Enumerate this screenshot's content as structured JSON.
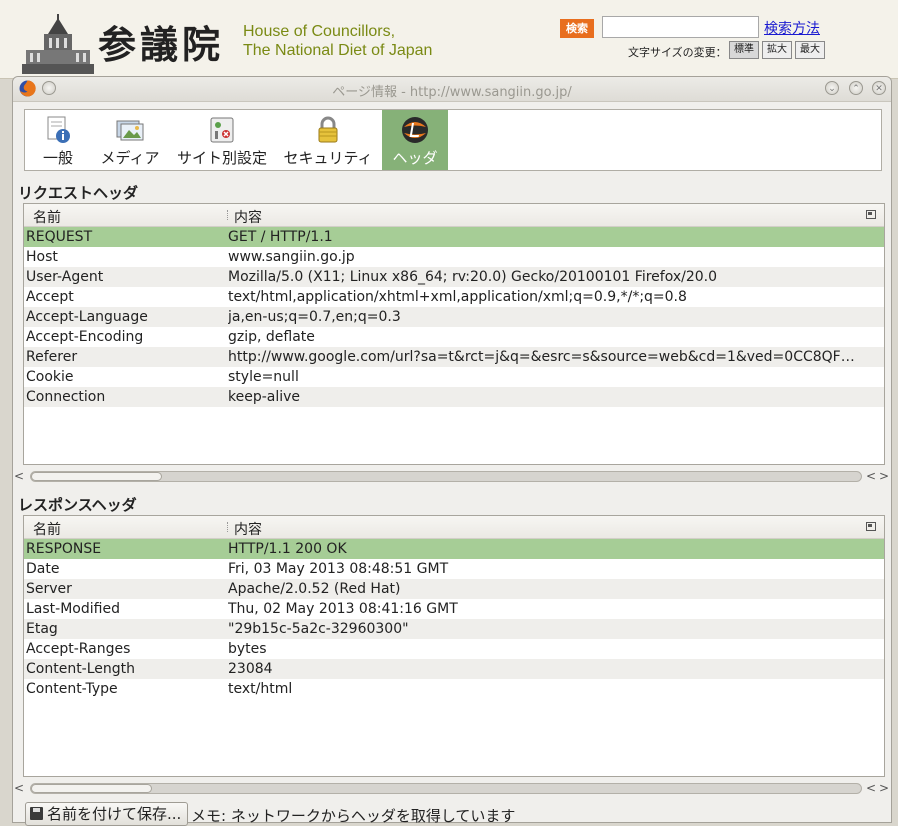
{
  "site": {
    "kanji": "参議院",
    "en_line1": "House of Councillors,",
    "en_line2": "The National Diet of Japan",
    "search_button": "検索",
    "search_method": "検索方法",
    "font_size_label": "文字サイズの変更：",
    "font_sizes": [
      "標準",
      "拡大",
      "最大"
    ]
  },
  "dialog": {
    "title": "ページ情報 - http://www.sangiin.go.jp/",
    "tabs": [
      {
        "label": "一般",
        "icon": "info-page-icon",
        "active": false
      },
      {
        "label": "メディア",
        "icon": "media-icon",
        "active": false
      },
      {
        "label": "サイト別設定",
        "icon": "permissions-icon",
        "active": false
      },
      {
        "label": "セキュリティ",
        "icon": "lock-icon",
        "active": false
      },
      {
        "label": "ヘッダ",
        "icon": "livehttp-headers-icon",
        "active": true
      }
    ],
    "request": {
      "title": "リクエストヘッダ",
      "col_name": "名前",
      "col_value": "内容",
      "rows": [
        {
          "name": "REQUEST",
          "value": "GET / HTTP/1.1",
          "selected": true
        },
        {
          "name": "Host",
          "value": "www.sangiin.go.jp"
        },
        {
          "name": "User-Agent",
          "value": "Mozilla/5.0 (X11; Linux x86_64; rv:20.0) Gecko/20100101 Firefox/20.0"
        },
        {
          "name": "Accept",
          "value": "text/html,application/xhtml+xml,application/xml;q=0.9,*/*;q=0.8"
        },
        {
          "name": "Accept-Language",
          "value": "ja,en-us;q=0.7,en;q=0.3"
        },
        {
          "name": "Accept-Encoding",
          "value": "gzip, deflate"
        },
        {
          "name": "Referer",
          "value": "http://www.google.com/url?sa=t&rct=j&q=&esrc=s&source=web&cd=1&ved=0CC8QF…"
        },
        {
          "name": "Cookie",
          "value": "style=null"
        },
        {
          "name": "Connection",
          "value": "keep-alive"
        }
      ]
    },
    "response": {
      "title": "レスポンスヘッダ",
      "col_name": "名前",
      "col_value": "内容",
      "rows": [
        {
          "name": "RESPONSE",
          "value": "HTTP/1.1 200 OK",
          "selected": true
        },
        {
          "name": "Date",
          "value": "Fri, 03 May 2013 08:48:51 GMT"
        },
        {
          "name": "Server",
          "value": "Apache/2.0.52 (Red Hat)"
        },
        {
          "name": "Last-Modified",
          "value": "Thu, 02 May 2013 08:41:16 GMT"
        },
        {
          "name": "Etag",
          "value": "\"29b15c-5a2c-32960300\""
        },
        {
          "name": "Accept-Ranges",
          "value": "bytes"
        },
        {
          "name": "Content-Length",
          "value": "23084"
        },
        {
          "name": "Content-Type",
          "value": "text/html"
        }
      ]
    },
    "save_button": "名前を付けて保存...",
    "memo": "メモ: ネットワークからヘッダを取得しています"
  },
  "colors": {
    "selected_row": "#a6cd96",
    "active_tab": "#86b178",
    "search_button": "#e86e1e"
  }
}
